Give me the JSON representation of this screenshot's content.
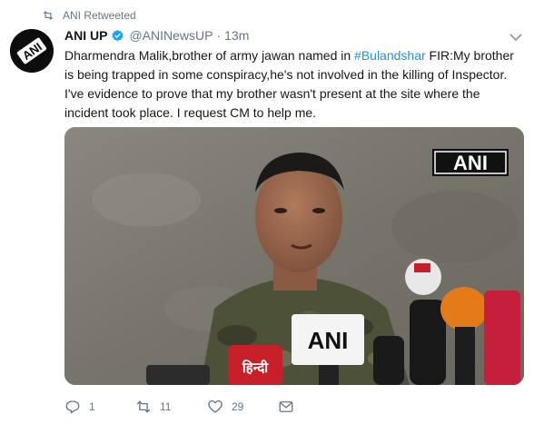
{
  "retweet_context": {
    "label": "ANI Retweeted"
  },
  "tweet": {
    "author_name": "ANI UP",
    "handle": "@ANINewsUP",
    "separator": "·",
    "time": "13m",
    "text_before": "Dharmendra Malik,brother of army jawan named in ",
    "hashtag": "#Bulandshar",
    "text_after": " FIR:My brother is being trapped in some conspiracy,he's not involved in the killing of Inspector. I've evidence to prove that my brother wasn't present at the site where the incident took place. I request CM to help me."
  },
  "avatar": {
    "logo_text": "ANI"
  },
  "media": {
    "watermark": "ANI",
    "mic_logo": "ANI",
    "hindi_mic_text": "हिन्दी"
  },
  "actions": {
    "reply_count": "1",
    "retweet_count": "11",
    "like_count": "29"
  },
  "colors": {
    "link": "#1b95e0",
    "muted": "#657786",
    "verified": "#1da1f2",
    "text": "#14171a"
  }
}
